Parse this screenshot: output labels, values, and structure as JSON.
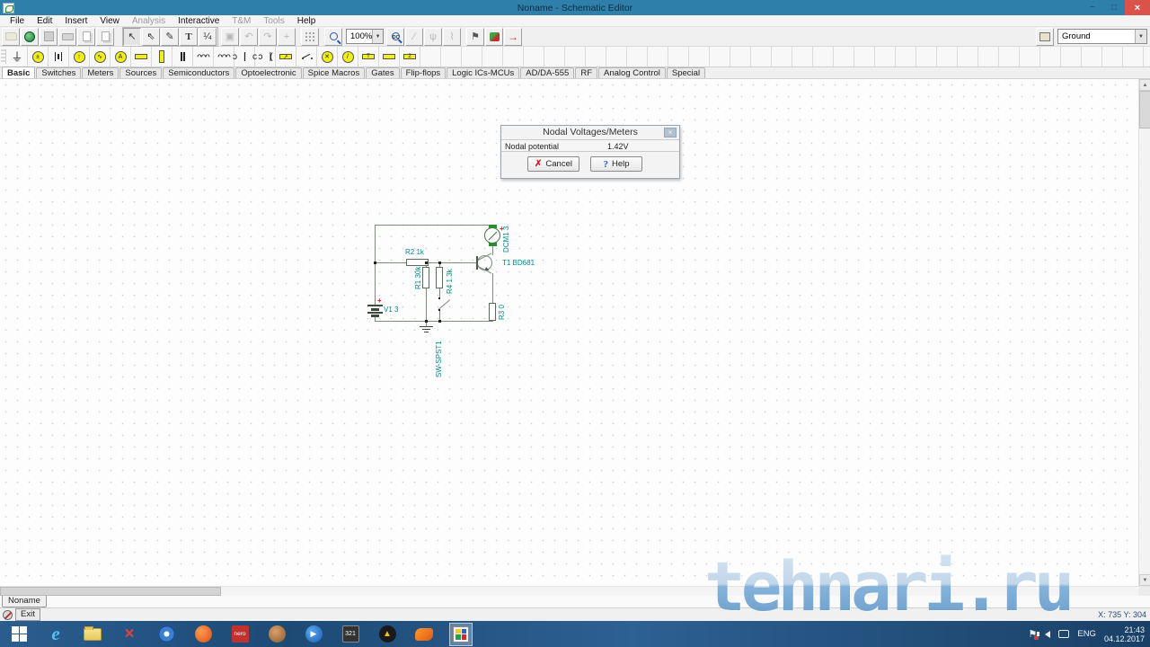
{
  "window": {
    "title": "Noname - Schematic Editor"
  },
  "icons": {
    "minimize": "−",
    "maximize": "□",
    "close": "×",
    "select_arrow": "↖",
    "hollow_arrow": "⇖",
    "wire_pen": "✎",
    "text_tool": "T",
    "dim_tool": "¼",
    "delete_tool": "▣",
    "undo": "↶",
    "redo": "↷",
    "move": "+",
    "flag": "⚑",
    "red_arrow": "→",
    "dropdown": "▼",
    "up_arrow": "▲",
    "down_arrow": "▼",
    "dc_label": "DC",
    "chip": "IC",
    "ground": "⏚",
    "sine": "∿",
    "amp": "A",
    "arrow_up": "↑",
    "plus_minus": "±",
    "coil": "ᴖᴖᴖ",
    "lamp_cross": "✕",
    "meter_slash": "/",
    "relay_t": "T",
    "block_two": "2",
    "dialog_close": "×",
    "cancel_x": "✗",
    "help_q": "?",
    "play": "▶"
  },
  "menu": {
    "items": [
      {
        "label": "File"
      },
      {
        "label": "Edit"
      },
      {
        "label": "Insert"
      },
      {
        "label": "View"
      },
      {
        "label": "Analysis"
      },
      {
        "label": "Interactive"
      },
      {
        "label": "T&M"
      },
      {
        "label": "Tools"
      },
      {
        "label": "Help"
      }
    ]
  },
  "toolbar": {
    "zoom_value": "100%",
    "ground_value": "Ground"
  },
  "component_tabs": [
    "Basic",
    "Switches",
    "Meters",
    "Sources",
    "Semiconductors",
    "Optoelectronic",
    "Spice Macros",
    "Gates",
    "Flip-flops",
    "Logic ICs-MCUs",
    "AD/DA-555",
    "RF",
    "Analog Control",
    "Special"
  ],
  "dialog": {
    "title": "Nodal Voltages/Meters",
    "field_label": "Nodal potential",
    "field_value": "1.42V",
    "cancel_label": "Cancel",
    "help_label": "Help"
  },
  "circuit": {
    "labels": {
      "v1": "V1 3",
      "r2": "R2 1k",
      "r1": "R1 30k",
      "r4": "R4 1.3k",
      "sw": "SW-SPST1",
      "t1": "T1 BD681",
      "dcm": "DCM1 3",
      "r3": "R3 0"
    }
  },
  "statusbar": {
    "sheet_tab": "Noname",
    "exit_label": "Exit",
    "coords": "X: 735 Y: 304"
  },
  "taskbar": {
    "nero_label": "nero",
    "mpc_label": "321",
    "lang": "ENG",
    "time": "21:43",
    "date": "04.12.2017"
  },
  "watermark": "tehnari.ru"
}
